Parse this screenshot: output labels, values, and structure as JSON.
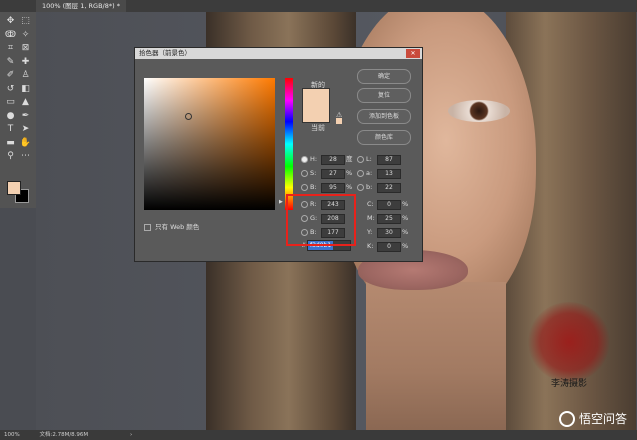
{
  "document_tab": {
    "label": "100% (图层 1, RGB/8*) *"
  },
  "toolbar": {
    "tools": [
      {
        "name": "move-tool-icon",
        "glyph": "✥"
      },
      {
        "name": "marquee-tool-icon",
        "glyph": "⬚"
      },
      {
        "name": "lasso-tool-icon",
        "glyph": "ↂ"
      },
      {
        "name": "magic-wand-tool-icon",
        "glyph": "✧"
      },
      {
        "name": "crop-tool-icon",
        "glyph": "⌗"
      },
      {
        "name": "frame-tool-icon",
        "glyph": "⊠"
      },
      {
        "name": "eyedropper-tool-icon",
        "glyph": "✎"
      },
      {
        "name": "healing-brush-tool-icon",
        "glyph": "✚"
      },
      {
        "name": "brush-tool-icon",
        "glyph": "✐"
      },
      {
        "name": "clone-stamp-tool-icon",
        "glyph": "♙"
      },
      {
        "name": "history-brush-tool-icon",
        "glyph": "↺"
      },
      {
        "name": "eraser-tool-icon",
        "glyph": "◧"
      },
      {
        "name": "gradient-tool-icon",
        "glyph": "▭"
      },
      {
        "name": "blur-tool-icon",
        "glyph": "▲"
      },
      {
        "name": "dodge-tool-icon",
        "glyph": "●"
      },
      {
        "name": "pen-tool-icon",
        "glyph": "✒"
      },
      {
        "name": "type-tool-icon",
        "glyph": "T"
      },
      {
        "name": "path-selection-tool-icon",
        "glyph": "➤"
      },
      {
        "name": "shape-tool-icon",
        "glyph": "▬"
      },
      {
        "name": "hand-tool-icon",
        "glyph": "✋"
      },
      {
        "name": "zoom-tool-icon",
        "glyph": "⚲"
      },
      {
        "name": "more-tools-icon",
        "glyph": "⋯"
      }
    ],
    "foreground_color": "#f3d0b1",
    "background_color": "#000000"
  },
  "color_picker": {
    "title": "拾色器（前景色）",
    "close_glyph": "✕",
    "label_new": "新的",
    "label_current": "当前",
    "new_color": "#f3d0b1",
    "current_color": "#f3d0b1",
    "gamut_warning_glyph": "⚠",
    "buttons": {
      "ok": "确定",
      "reset": "复位",
      "add_to_swatches": "添加到色板",
      "color_libraries": "颜色库"
    },
    "only_web_colors": "只有 Web 颜色",
    "hsb": {
      "h_label": "H:",
      "h_value": "28",
      "h_unit": "度",
      "s_label": "S:",
      "s_value": "27",
      "s_unit": "%",
      "b_label": "B:",
      "b_value": "95",
      "b_unit": "%"
    },
    "lab": {
      "l_label": "L:",
      "l_value": "87",
      "a_label": "a:",
      "a_value": "13",
      "b_label": "b:",
      "b_value": "22"
    },
    "rgb": {
      "r_label": "R:",
      "r_value": "243",
      "g_label": "G:",
      "g_value": "208",
      "b_label": "B:",
      "b_value": "177"
    },
    "cmyk": {
      "c_label": "C:",
      "c_value": "0",
      "c_unit": "%",
      "m_label": "M:",
      "m_value": "25",
      "m_unit": "%",
      "y_label": "Y:",
      "y_value": "30",
      "y_unit": "%",
      "k_label": "K:",
      "k_value": "0",
      "k_unit": "%"
    },
    "hex_label": "#",
    "hex_value": "f3d0b1"
  },
  "status_bar": {
    "zoom": "100%",
    "doc_info": "文档:2.78M/8.96M",
    "arrow_glyph": "›"
  },
  "watermark": {
    "stamp_text": "李涛摄影",
    "brand": "悟空问答"
  }
}
